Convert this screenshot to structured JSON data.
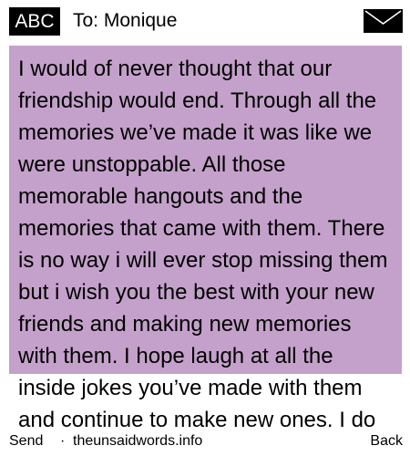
{
  "header": {
    "input_mode": "ABC",
    "recipient": "To: Monique",
    "envelope_icon": "envelope-icon"
  },
  "message": {
    "text": "I would of never thought that our friendship would end. Through all the memories we’ve made it was like we were unstoppable. All those memorable hangouts and the memories that came with them. There is no way i will ever stop missing them but i wish you the best with your new friends and making new memories with them. I hope laugh at all the inside jokes you’ve made with them and continue to make new ones. I do"
  },
  "footer": {
    "send_label": "Send",
    "separator": "·",
    "site": "theunsaidwords.info",
    "back_label": "Back"
  },
  "colors": {
    "message_background": "#c4a1cb",
    "badge_background": "#000000"
  }
}
